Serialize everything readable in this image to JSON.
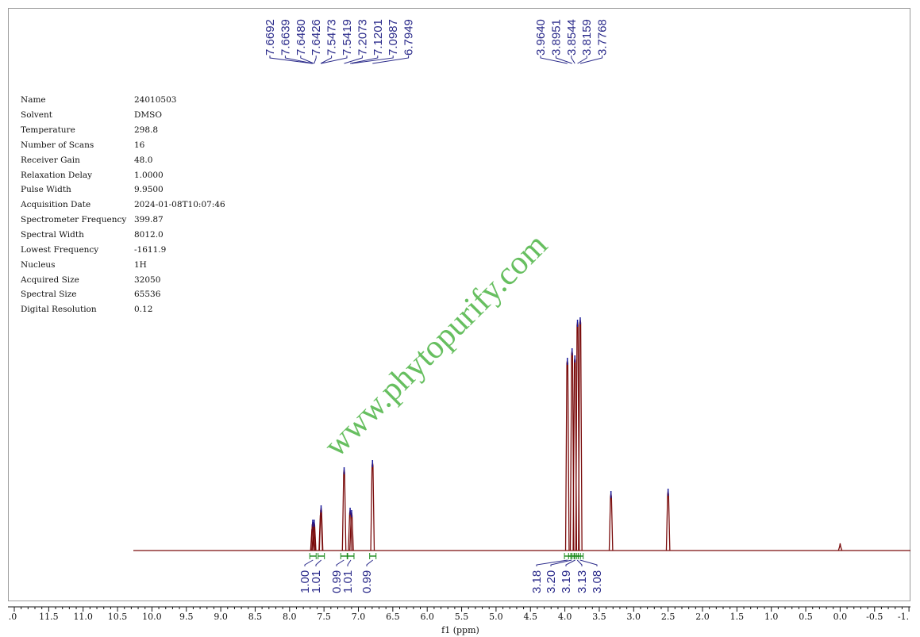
{
  "parameters": [
    {
      "key": "Name",
      "value": "24010503"
    },
    {
      "key": "Solvent",
      "value": "DMSO"
    },
    {
      "key": "Temperature",
      "value": "298.8"
    },
    {
      "key": "Number of Scans",
      "value": "16"
    },
    {
      "key": "Receiver Gain",
      "value": "48.0"
    },
    {
      "key": "Relaxation Delay",
      "value": "1.0000"
    },
    {
      "key": "Pulse Width",
      "value": "9.9500"
    },
    {
      "key": "Acquisition Date",
      "value": "2024-01-08T10:07:46"
    },
    {
      "key": "Spectrometer Frequency",
      "value": "399.87"
    },
    {
      "key": "Spectral Width",
      "value": "8012.0"
    },
    {
      "key": "Lowest Frequency",
      "value": "-1611.9"
    },
    {
      "key": "Nucleus",
      "value": "1H"
    },
    {
      "key": "Acquired Size",
      "value": "32050"
    },
    {
      "key": "Spectral Size",
      "value": "65536"
    },
    {
      "key": "Digital Resolution",
      "value": "0.12"
    }
  ],
  "watermark": "www.phytopurify.com",
  "colors": {
    "spectrum": "#7a0c0c",
    "peak_marker": "#1a1a9a",
    "label": "#2a2a8a",
    "integral": "#1a8a1a",
    "watermark": "#57b84f"
  },
  "chart_data": {
    "type": "line",
    "title": "",
    "xlabel": "f1 (ppm)",
    "ylabel": "",
    "xlim": [
      12.0,
      -1.0
    ],
    "x_reversed": true,
    "x_ticks": [
      ".0",
      "11.5",
      "11.0",
      "10.5",
      "10.0",
      "9.5",
      "9.0",
      "8.5",
      "8.0",
      "7.5",
      "7.0",
      "6.5",
      "6.0",
      "5.5",
      "5.0",
      "4.5",
      "4.0",
      "3.5",
      "3.0",
      "2.5",
      "2.0",
      "1.5",
      "1.0",
      "0.5",
      "0.0",
      "-0.5",
      "-1."
    ],
    "peak_labels_group1": [
      "7.6692",
      "7.6639",
      "7.6480",
      "7.6426",
      "7.5473",
      "7.5419",
      "7.2073",
      "7.1201",
      "7.0987",
      "6.7949"
    ],
    "peak_labels_group2": [
      "3.9640",
      "3.8951",
      "3.8544",
      "3.8159",
      "3.7768"
    ],
    "integrals": [
      {
        "ppm": 7.66,
        "value": "1.00"
      },
      {
        "ppm": 7.54,
        "value": "1.01"
      },
      {
        "ppm": 7.21,
        "value": "0.99"
      },
      {
        "ppm": 7.11,
        "value": "1.01"
      },
      {
        "ppm": 6.79,
        "value": "0.99"
      },
      {
        "ppm": 3.96,
        "value": "3.18"
      },
      {
        "ppm": 3.9,
        "value": "3.20"
      },
      {
        "ppm": 3.85,
        "value": "3.19"
      },
      {
        "ppm": 3.82,
        "value": "3.13"
      },
      {
        "ppm": 3.78,
        "value": "3.08"
      }
    ],
    "peaks": [
      {
        "ppm": 7.6692,
        "h": 0.1
      },
      {
        "ppm": 7.6639,
        "h": 0.12
      },
      {
        "ppm": 7.648,
        "h": 0.11
      },
      {
        "ppm": 7.6426,
        "h": 0.12
      },
      {
        "ppm": 7.5473,
        "h": 0.16
      },
      {
        "ppm": 7.5419,
        "h": 0.18
      },
      {
        "ppm": 7.2073,
        "h": 0.34
      },
      {
        "ppm": 7.1201,
        "h": 0.17
      },
      {
        "ppm": 7.0987,
        "h": 0.16
      },
      {
        "ppm": 6.7949,
        "h": 0.37
      },
      {
        "ppm": 3.964,
        "h": 0.8
      },
      {
        "ppm": 3.8951,
        "h": 0.84
      },
      {
        "ppm": 3.8544,
        "h": 0.81
      },
      {
        "ppm": 3.8159,
        "h": 0.96
      },
      {
        "ppm": 3.7768,
        "h": 0.97
      },
      {
        "ppm": 3.33,
        "h": 0.24
      },
      {
        "ppm": 2.5,
        "h": 0.25
      },
      {
        "ppm": 0.0,
        "h": 0.03
      }
    ]
  }
}
